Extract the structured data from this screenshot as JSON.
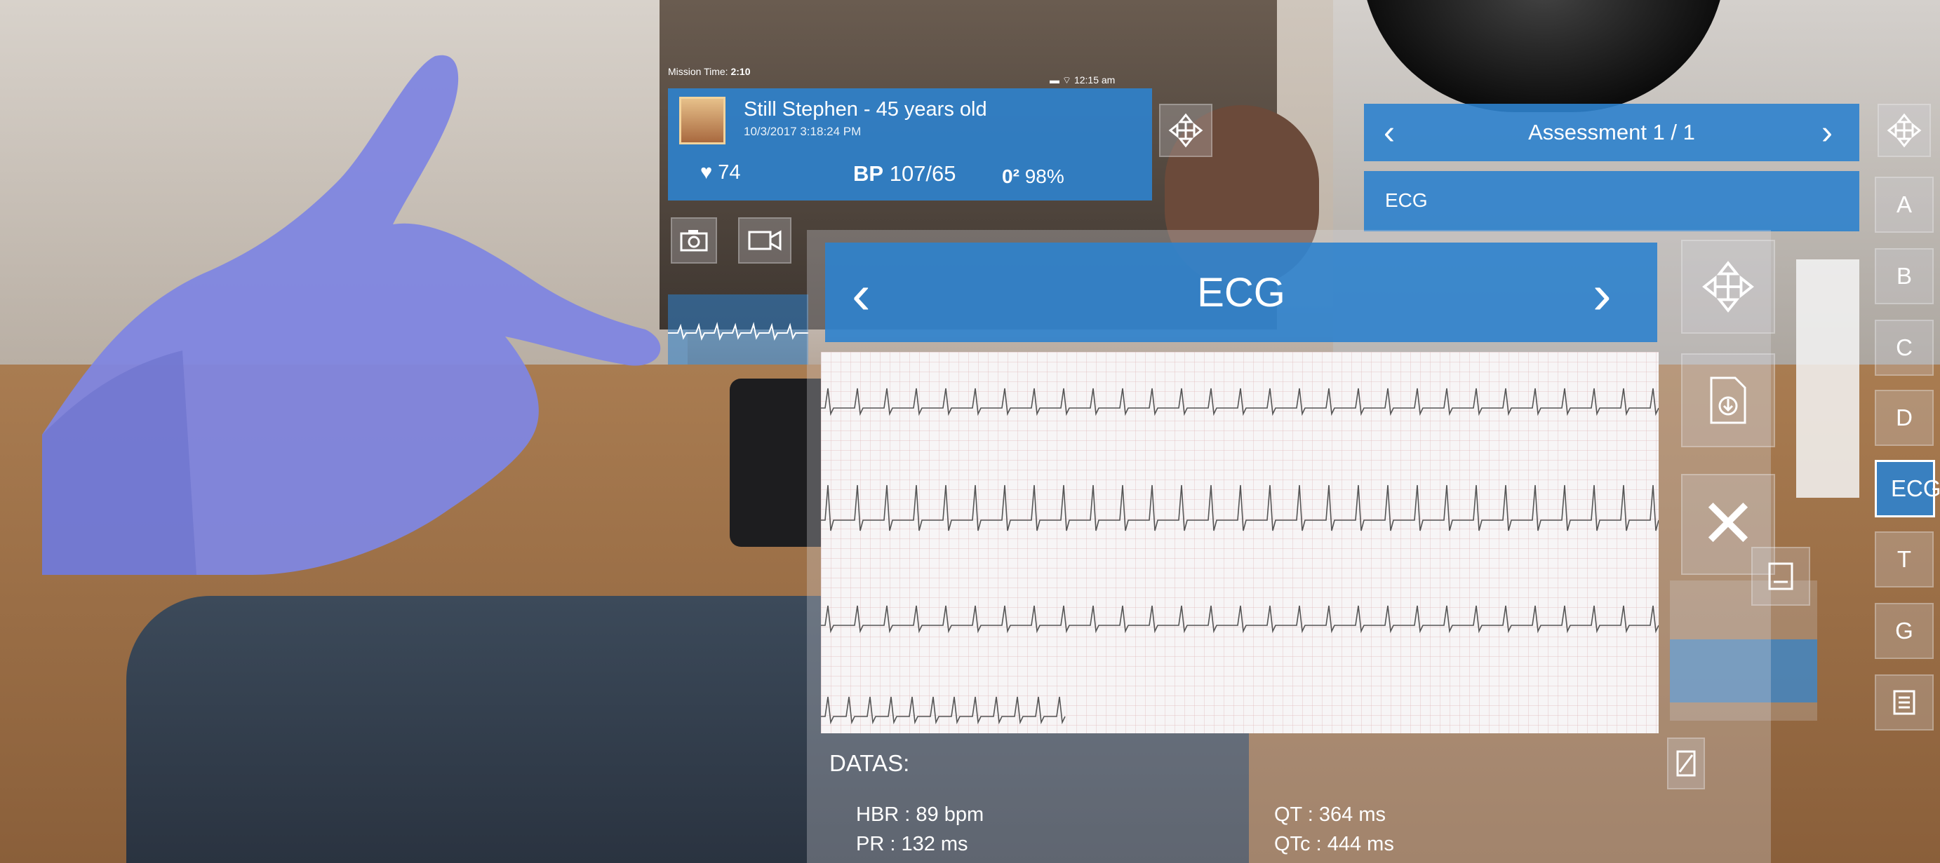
{
  "hud": {
    "mission_time_label": "Mission Time:",
    "mission_time_value": "2:10",
    "clock": "12:15 am"
  },
  "patient": {
    "name": "Still Stephen - 45 years old",
    "datetime": "10/3/2017 3:18:24 PM",
    "heart_rate": "74",
    "bp_label": "BP",
    "bp_value": "107/65",
    "o2_label": "0²",
    "o2_value": "98%"
  },
  "assessment": {
    "title": "Assessment 1 / 1",
    "prev": "‹",
    "next": "›",
    "current_item": "ECG"
  },
  "nav": {
    "items": [
      "A",
      "B",
      "C",
      "D",
      "ECG",
      "T",
      "G"
    ],
    "selected": "ECG"
  },
  "ecg_window": {
    "title": "ECG",
    "prev": "‹",
    "next": "›",
    "close": "✕",
    "datas_title": "DATAS:",
    "hbr": "HBR : 89 bpm",
    "pr": "PR : 132 ms",
    "qt": "QT : 364 ms",
    "qtc": "QTc : 444 ms"
  },
  "colors": {
    "panel_blue": "#2e82cd",
    "text": "#ffffff"
  },
  "icons": {
    "move": "move-arrows-icon",
    "camera": "camera-icon",
    "video": "video-camera-icon",
    "heart": "heart-icon",
    "export": "document-export-icon",
    "close": "close-icon",
    "document": "document-icon"
  }
}
